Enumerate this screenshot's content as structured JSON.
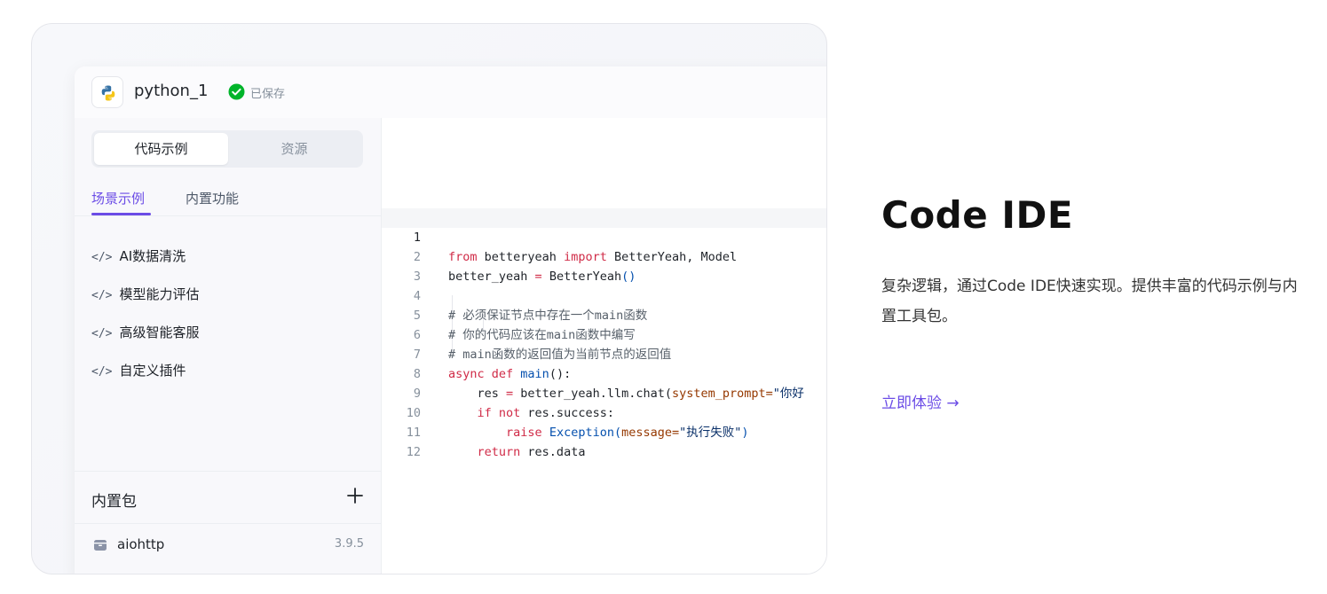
{
  "colors": {
    "accent": "#6b4ce6",
    "saved_green": "#00b42a",
    "keyword": "#d02b47",
    "function": "#0550ae"
  },
  "ide": {
    "file_name": "python_1",
    "saved_text": "已保存",
    "language_icon": "python-logo-icon",
    "segment": {
      "active": "代码示例",
      "inactive": "资源"
    },
    "subtabs": {
      "active": "场景示例",
      "inactive": "内置功能"
    },
    "scene_items": [
      {
        "icon": "</>",
        "label": "AI数据清洗"
      },
      {
        "icon": "</>",
        "label": "模型能力评估"
      },
      {
        "icon": "</>",
        "label": "高级智能客服"
      },
      {
        "icon": "</>",
        "label": "自定义插件"
      }
    ],
    "builtin": {
      "title": "内置包",
      "packages": [
        {
          "name": "aiohttp",
          "version": "3.9.5"
        }
      ]
    },
    "code_lines": [
      "1",
      "2",
      "3",
      "4",
      "5",
      "6",
      "7",
      "8",
      "9",
      "10",
      "11",
      "12"
    ],
    "code": {
      "l1a": "from",
      "l1b": " betteryeah ",
      "l1c": "import",
      "l1d": " BetterYeah, Model",
      "l2a": "better_yeah ",
      "l2b": "=",
      "l2c": " ",
      "l2d": "BetterYeah",
      "l2e": "()",
      "l4": "# 必须保证节点中存在一个main函数",
      "l5": "# 你的代码应该在main函数中编写",
      "l6": "# main函数的返回值为当前节点的返回值",
      "l7a": "async def",
      "l7b": " ",
      "l7c": "main",
      "l7d": "():",
      "l8a": "    res ",
      "l8b": "=",
      "l8c": " better_yeah.llm.chat(",
      "l8d": "system_prompt=",
      "l8e": "\"你好",
      "l9a": "    ",
      "l9b": "if not",
      "l9c": " res.success:",
      "l10a": "        ",
      "l10b": "raise",
      "l10c": " ",
      "l10d": "Exception(",
      "l10e": "message=",
      "l10f": "\"执行失败\"",
      "l10g": ")",
      "l11a": "    ",
      "l11b": "return",
      "l11c": " res.data"
    }
  },
  "right": {
    "title": "Code IDE",
    "description": "复杂逻辑，通过Code IDE快速实现。提供丰富的代码示例与内置工具包。",
    "link": "立即体验 →"
  }
}
